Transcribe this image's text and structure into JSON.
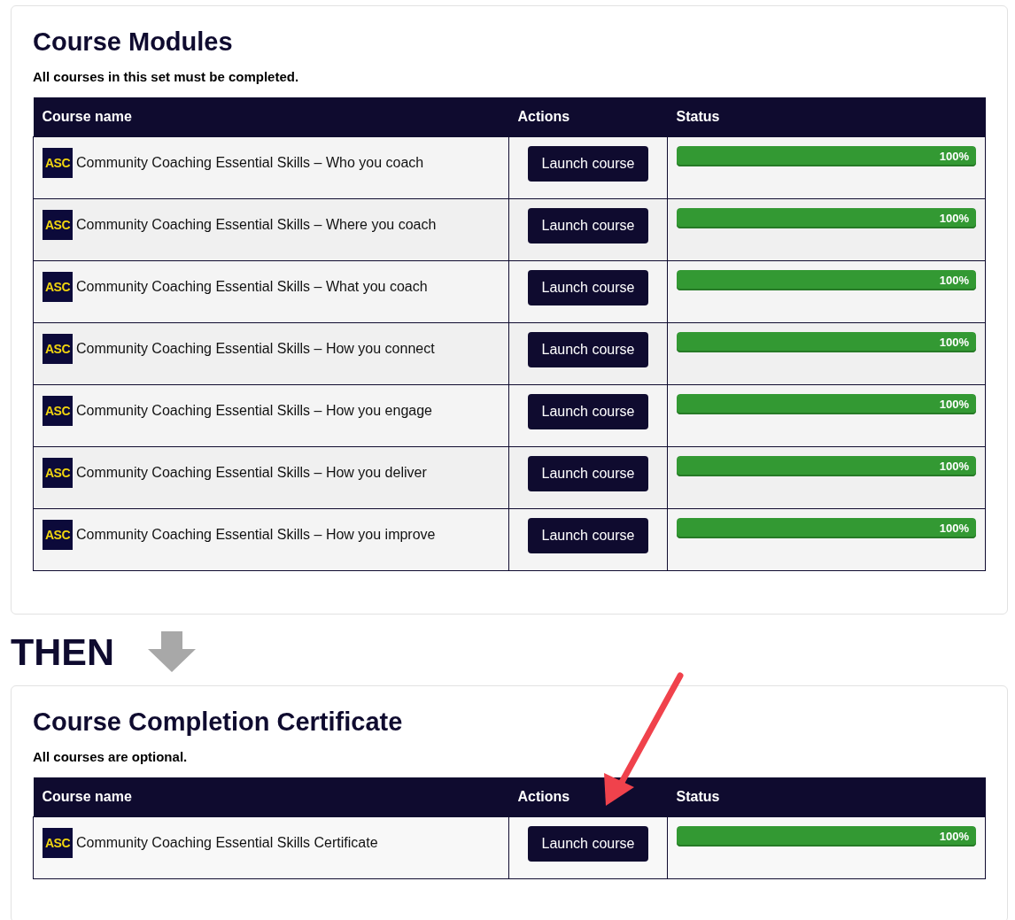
{
  "sections": [
    {
      "title": "Course Modules",
      "subtitle": "All courses in this set must be completed.",
      "columns": [
        "Course name",
        "Actions",
        "Status"
      ],
      "rows": [
        {
          "logo": "ASC",
          "name": "Community Coaching Essential Skills – Who you coach",
          "action": "Launch course",
          "level": 1,
          "reading": "100%"
        },
        {
          "logo": "ASC",
          "name": "Community Coaching Essential Skills – Where you coach",
          "action": "Launch course",
          "level": 1,
          "reading": "100%"
        },
        {
          "logo": "ASC",
          "name": "Community Coaching Essential Skills – What you coach",
          "action": "Launch course",
          "level": 1,
          "reading": "100%"
        },
        {
          "logo": "ASC",
          "name": "Community Coaching Essential Skills – How you connect",
          "action": "Launch course",
          "level": 1,
          "reading": "100%"
        },
        {
          "logo": "ASC",
          "name": "Community Coaching Essential Skills – How you engage",
          "action": "Launch course",
          "level": 1,
          "reading": "100%"
        },
        {
          "logo": "ASC",
          "name": "Community Coaching Essential Skills – How you deliver",
          "action": "Launch course",
          "level": 1,
          "reading": "100%"
        },
        {
          "logo": "ASC",
          "name": "Community Coaching Essential Skills – How you improve",
          "action": "Launch course",
          "level": 1,
          "reading": "100%"
        }
      ]
    },
    {
      "title": "Course Completion Certificate",
      "subtitle": "All courses are optional.",
      "columns": [
        "Course name",
        "Actions",
        "Status"
      ],
      "rows": [
        {
          "logo": "ASC",
          "name": "Community Coaching Essential Skills Certificate",
          "action": "Launch course",
          "level": 1,
          "reading": "100%"
        }
      ]
    }
  ],
  "separator": {
    "label": "THEN"
  }
}
